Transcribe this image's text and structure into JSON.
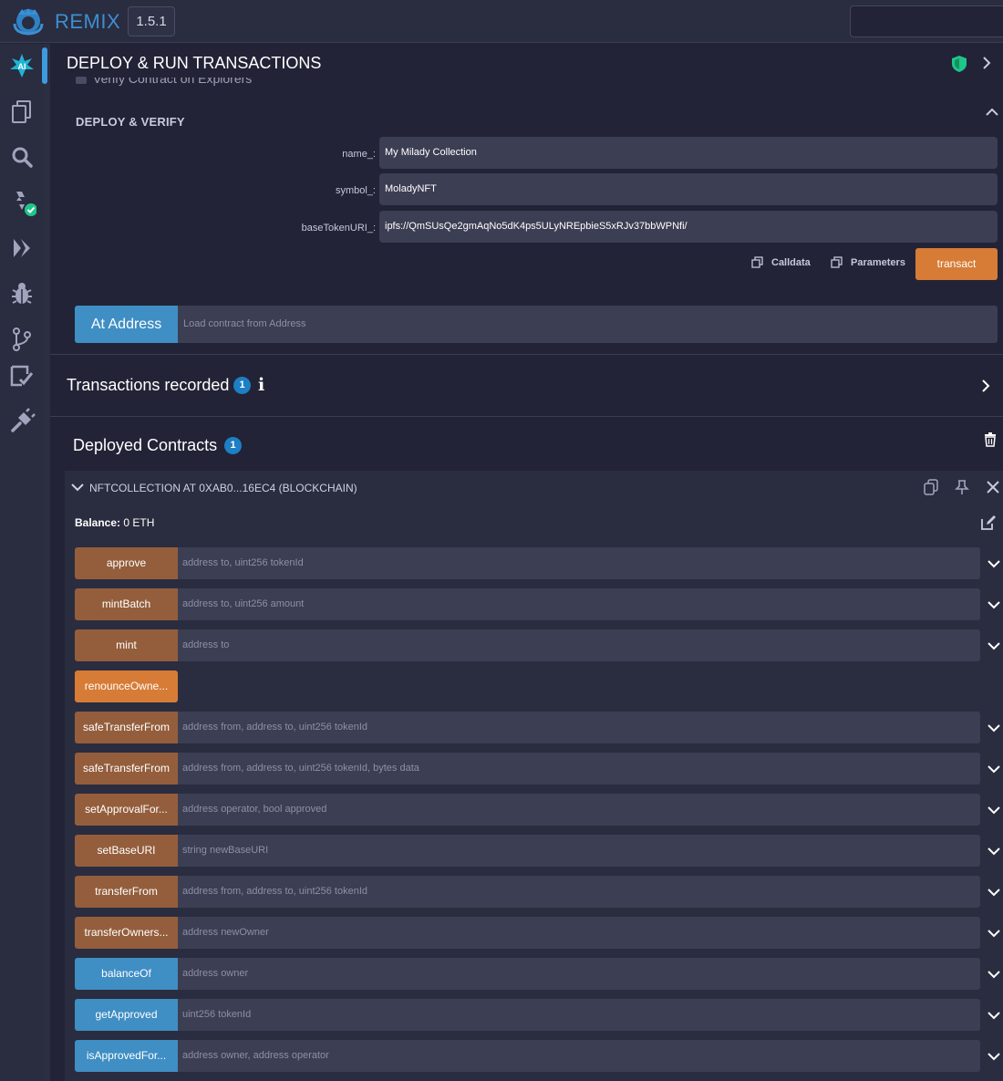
{
  "topbar": {
    "brand": "REMIX",
    "version": "1.5.1"
  },
  "iconbar": {
    "items": [
      "ai-assistant-icon",
      "file-explorer-icon",
      "search-icon",
      "solidity-compiler-icon",
      "deploy-run-icon",
      "debugger-icon",
      "git-icon",
      "unit-testing-icon",
      "plugin-manager-icon"
    ]
  },
  "panel": {
    "title": "DEPLOY & RUN TRANSACTIONS",
    "verify_label": "Verify Contract on Explorers",
    "deploy_section": "DEPLOY & VERIFY",
    "fields": [
      {
        "label": "name_:",
        "value": "My Milady Collection"
      },
      {
        "label": "symbol_:",
        "value": "MoladyNFT"
      },
      {
        "label": "baseTokenURI_:",
        "value": "ipfs://QmSUsQe2gmAqNo5dK4ps5ULyNREpbieS5xRJv37bbWPNfi/"
      }
    ],
    "calldata_label": "Calldata",
    "parameters_label": "Parameters",
    "transact_label": "transact",
    "at_address_label": "At Address",
    "at_address_placeholder": "Load contract from Address",
    "transactions_title": "Transactions recorded",
    "transactions_count": "1",
    "deployed_title": "Deployed Contracts",
    "deployed_count": "1",
    "colors": {
      "accent_blue": "#3f8ec4",
      "nonpayable": "#945e3c",
      "payable": "#d77c36",
      "badge": "#1d7fc4",
      "shield_green": "#1fc58a"
    }
  },
  "instance": {
    "title": "NFTCOLLECTION AT 0XAB0...16EC4 (BLOCKCHAIN)",
    "balance_label": "Balance:",
    "balance_value": "0 ETH",
    "functions": [
      {
        "name": "approve",
        "kind": "nonpay",
        "params": "address to, uint256 tokenId",
        "expandable": true
      },
      {
        "name": "mintBatch",
        "kind": "nonpay",
        "params": "address to, uint256 amount",
        "expandable": true
      },
      {
        "name": "mint",
        "kind": "nonpay",
        "params": "address to",
        "expandable": true
      },
      {
        "name": "renounceOwne...",
        "kind": "pay",
        "params": "",
        "expandable": false
      },
      {
        "name": "safeTransferFrom",
        "kind": "nonpay",
        "params": "address from, address to, uint256 tokenId",
        "expandable": true
      },
      {
        "name": "safeTransferFrom",
        "kind": "nonpay",
        "params": "address from, address to, uint256 tokenId, bytes data",
        "expandable": true
      },
      {
        "name": "setApprovalFor...",
        "kind": "nonpay",
        "params": "address operator, bool approved",
        "expandable": true
      },
      {
        "name": "setBaseURI",
        "kind": "nonpay",
        "params": "string newBaseURI",
        "expandable": true
      },
      {
        "name": "transferFrom",
        "kind": "nonpay",
        "params": "address from, address to, uint256 tokenId",
        "expandable": true
      },
      {
        "name": "transferOwners...",
        "kind": "nonpay",
        "params": "address newOwner",
        "expandable": true
      },
      {
        "name": "balanceOf",
        "kind": "view",
        "params": "address owner",
        "expandable": true
      },
      {
        "name": "getApproved",
        "kind": "view",
        "params": "uint256 tokenId",
        "expandable": true
      },
      {
        "name": "isApprovedFor...",
        "kind": "view",
        "params": "address owner, address operator",
        "expandable": true
      }
    ]
  }
}
